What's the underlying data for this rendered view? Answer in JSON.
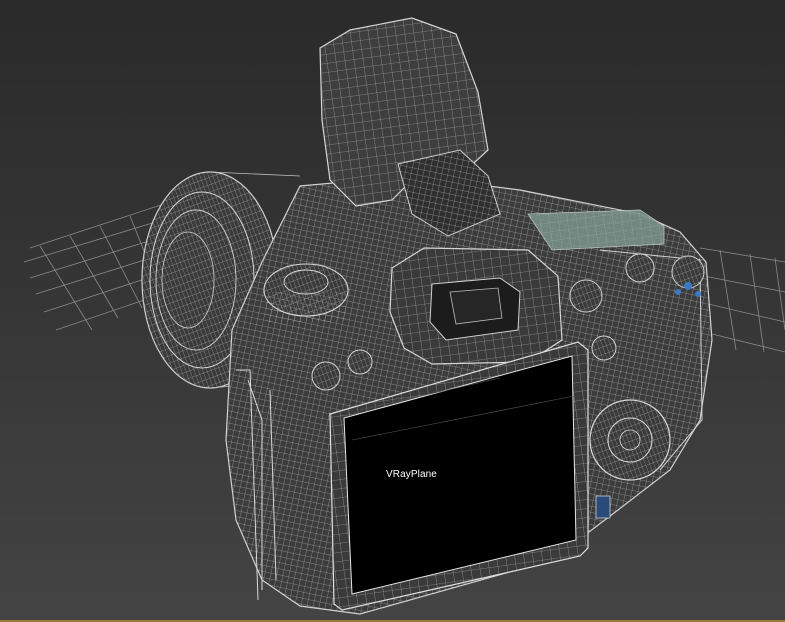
{
  "viewport": {
    "render_mode": "wireframe",
    "selected_object_label": "VRayPlane",
    "colors": {
      "background_top": "#2a2a2a",
      "background_bottom": "#444444",
      "wire": "#c8c8c8",
      "grid": "#8a8a8a",
      "screen_fill": "#000000",
      "lcd_tint": "#8fb0a0",
      "button_accent": "#3a78c8",
      "active_viewport_edge": "#9a7a3a"
    }
  }
}
